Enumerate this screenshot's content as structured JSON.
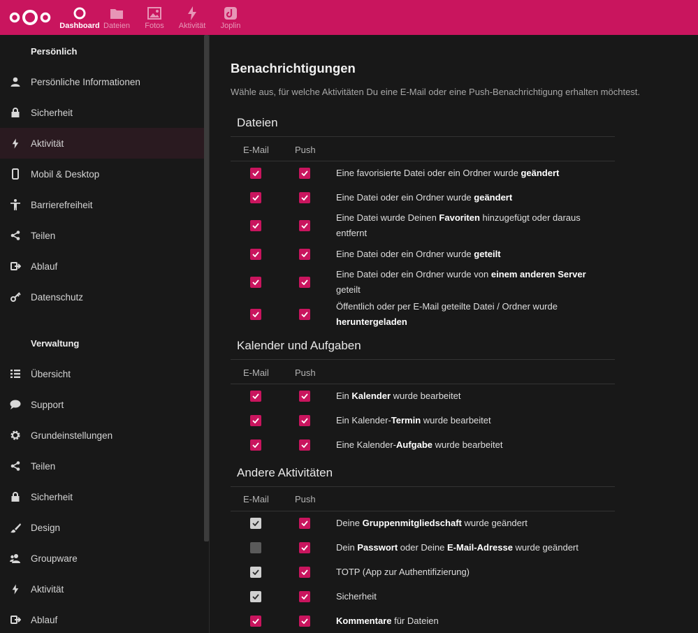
{
  "topbar": {
    "apps": [
      {
        "label": "Dashboard",
        "icon": "dashboard-circle-icon",
        "active": true
      },
      {
        "label": "Dateien",
        "icon": "folder-icon"
      },
      {
        "label": "Fotos",
        "icon": "image-icon"
      },
      {
        "label": "Aktivität",
        "icon": "lightning-icon"
      },
      {
        "label": "Joplin",
        "icon": "joplin-icon"
      }
    ],
    "accent": "#c9155e"
  },
  "sidebar": {
    "personal_title": "Persönlich",
    "personal_items": [
      {
        "label": "Persönliche Informationen",
        "icon": "user-icon"
      },
      {
        "label": "Sicherheit",
        "icon": "lock-icon"
      },
      {
        "label": "Aktivität",
        "icon": "lightning-icon",
        "active": true
      },
      {
        "label": "Mobil & Desktop",
        "icon": "phone-icon"
      },
      {
        "label": "Barrierefreiheit",
        "icon": "accessibility-icon"
      },
      {
        "label": "Teilen",
        "icon": "share-icon"
      },
      {
        "label": "Ablauf",
        "icon": "flow-icon"
      },
      {
        "label": "Datenschutz",
        "icon": "key-icon"
      }
    ],
    "admin_title": "Verwaltung",
    "admin_items": [
      {
        "label": "Übersicht",
        "icon": "list-icon"
      },
      {
        "label": "Support",
        "icon": "speech-bubble-icon"
      },
      {
        "label": "Grundeinstellungen",
        "icon": "gear-icon"
      },
      {
        "label": "Teilen",
        "icon": "share-icon"
      },
      {
        "label": "Sicherheit",
        "icon": "lock-icon"
      },
      {
        "label": "Design",
        "icon": "brush-icon"
      },
      {
        "label": "Groupware",
        "icon": "group-icon"
      },
      {
        "label": "Aktivität",
        "icon": "lightning-icon"
      },
      {
        "label": "Ablauf",
        "icon": "flow-icon"
      }
    ]
  },
  "main": {
    "title": "Benachrichtigungen",
    "description": "Wähle aus, für welche Aktivitäten Du eine E-Mail oder eine Push-Benachrichtigung erhalten möchtest.",
    "col_email": "E-Mail",
    "col_push": "Push",
    "groups": [
      {
        "title": "Dateien",
        "rows": [
          {
            "parts": [
              [
                "Eine favorisierte Datei oder ein Ordner wurde ",
                false
              ],
              [
                "geändert",
                true
              ]
            ],
            "email": "pink",
            "push": "pink"
          },
          {
            "parts": [
              [
                "Eine Datei oder ein Ordner wurde ",
                false
              ],
              [
                "geändert",
                true
              ]
            ],
            "email": "pink",
            "push": "pink"
          },
          {
            "parts": [
              [
                "Eine Datei wurde Deinen ",
                false
              ],
              [
                "Favoriten",
                true
              ],
              [
                " hinzugefügt oder daraus entfernt",
                false
              ]
            ],
            "email": "pink",
            "push": "pink"
          },
          {
            "parts": [
              [
                "Eine Datei oder ein Ordner wurde ",
                false
              ],
              [
                "geteilt",
                true
              ]
            ],
            "email": "pink",
            "push": "pink"
          },
          {
            "parts": [
              [
                "Eine Datei oder ein Ordner wurde von ",
                false
              ],
              [
                "einem anderen Server",
                true
              ],
              [
                " geteilt",
                false
              ]
            ],
            "email": "pink",
            "push": "pink"
          },
          {
            "parts": [
              [
                "Öffentlich oder per E-Mail geteilte Datei / Ordner wurde ",
                false
              ],
              [
                "heruntergeladen",
                true
              ]
            ],
            "email": "pink",
            "push": "pink"
          }
        ]
      },
      {
        "title": "Kalender und Aufgaben",
        "rows": [
          {
            "parts": [
              [
                "Ein ",
                false
              ],
              [
                "Kalender",
                true
              ],
              [
                " wurde bearbeitet",
                false
              ]
            ],
            "email": "pink",
            "push": "pink"
          },
          {
            "parts": [
              [
                "Ein Kalender-",
                false
              ],
              [
                "Termin",
                true
              ],
              [
                " wurde bearbeitet",
                false
              ]
            ],
            "email": "pink",
            "push": "pink"
          },
          {
            "parts": [
              [
                "Eine Kalender-",
                false
              ],
              [
                "Aufgabe",
                true
              ],
              [
                " wurde bearbeitet",
                false
              ]
            ],
            "email": "pink",
            "push": "pink"
          }
        ]
      },
      {
        "title": "Andere Aktivitäten",
        "rows": [
          {
            "parts": [
              [
                "Deine ",
                false
              ],
              [
                "Gruppenmitgliedschaft",
                true
              ],
              [
                " wurde geändert",
                false
              ]
            ],
            "email": "grey",
            "push": "pink"
          },
          {
            "parts": [
              [
                "Dein ",
                false
              ],
              [
                "Passwort",
                true
              ],
              [
                " oder Deine ",
                false
              ],
              [
                "E-Mail-Adresse",
                true
              ],
              [
                " wurde geändert",
                false
              ]
            ],
            "email": "empty",
            "push": "pink"
          },
          {
            "parts": [
              [
                "TOTP (App zur Authentifizierung)",
                false
              ]
            ],
            "email": "grey",
            "push": "pink"
          },
          {
            "parts": [
              [
                "Sicherheit",
                false
              ]
            ],
            "email": "grey",
            "push": "pink"
          },
          {
            "parts": [
              [
                "Kommentare",
                true
              ],
              [
                " für Dateien",
                false
              ]
            ],
            "email": "pink",
            "push": "pink"
          }
        ]
      }
    ]
  }
}
